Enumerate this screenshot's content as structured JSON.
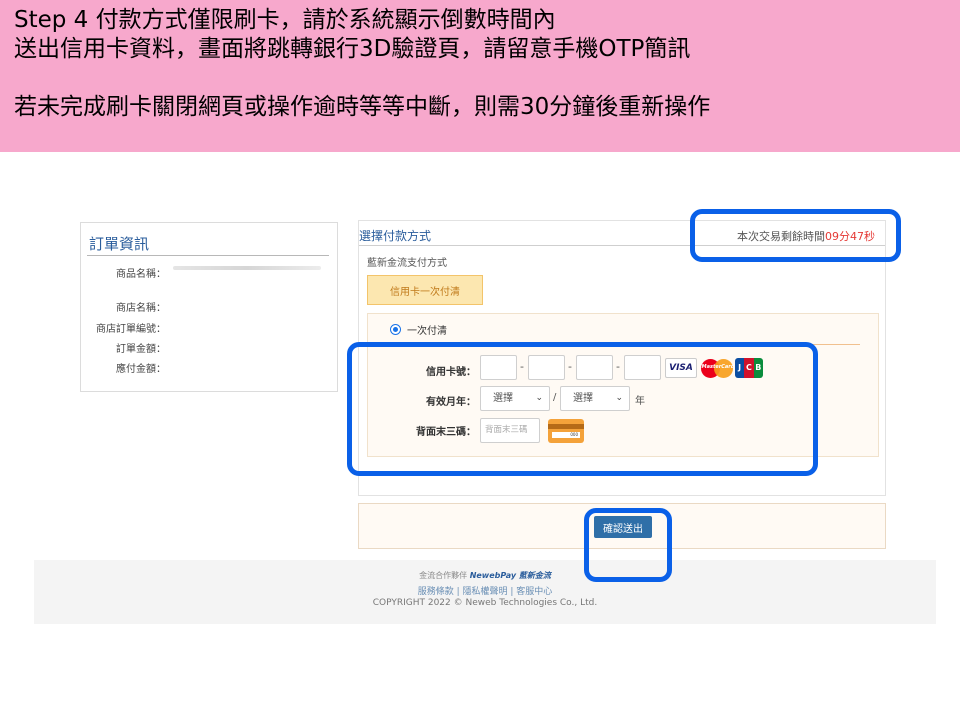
{
  "banner": {
    "line1": "Step 4 付款方式僅限刷卡，請於系統顯示倒數時間內",
    "line2": "送出信用卡資料，畫面將跳轉銀行3D驗證頁，請留意手機OTP簡訊",
    "line3": "若未完成刷卡關閉網頁或操作逾時等等中斷，則需30分鐘後重新操作",
    "bg_color": "#f7a8cc"
  },
  "order": {
    "title": "訂單資訊",
    "labels": [
      "商品名稱：",
      "商店名稱：",
      "商店訂單編號：",
      "訂單金額：",
      "應付金額："
    ]
  },
  "payment": {
    "title": "選擇付款方式",
    "timer_label": "本次交易剩餘時間",
    "timer_min": "09",
    "min_unit": "分",
    "timer_sec": "47",
    "sec_unit": "秒",
    "subtitle": "藍新金流支付方式",
    "method_button": "信用卡一次付清",
    "radio_label": "一次付清",
    "card_number_label": "信用卡號：",
    "expiry_label": "有效月年：",
    "month_select": "選擇",
    "year_select": "選擇",
    "slash": "/",
    "year_unit": "年",
    "cvc_label": "背面末三碼：",
    "cvc_placeholder": "背面末三碼",
    "dash": "-",
    "visa_text": "VISA",
    "mc_text": "MasterCard",
    "jcb_text": [
      "J",
      "C",
      "B"
    ],
    "cvc_card_text": "000"
  },
  "submit": {
    "label": "確認送出",
    "color": "#2f6fa8"
  },
  "footer": {
    "partner_text": "金流合作夥伴",
    "brand": "NewebPay 藍新金流",
    "links": "服務條款 | 隱私權聲明 | 客服中心",
    "copyright": "COPYRIGHT 2022 © Neweb Technologies Co., Ltd."
  },
  "highlight_color": "#0a60e8"
}
